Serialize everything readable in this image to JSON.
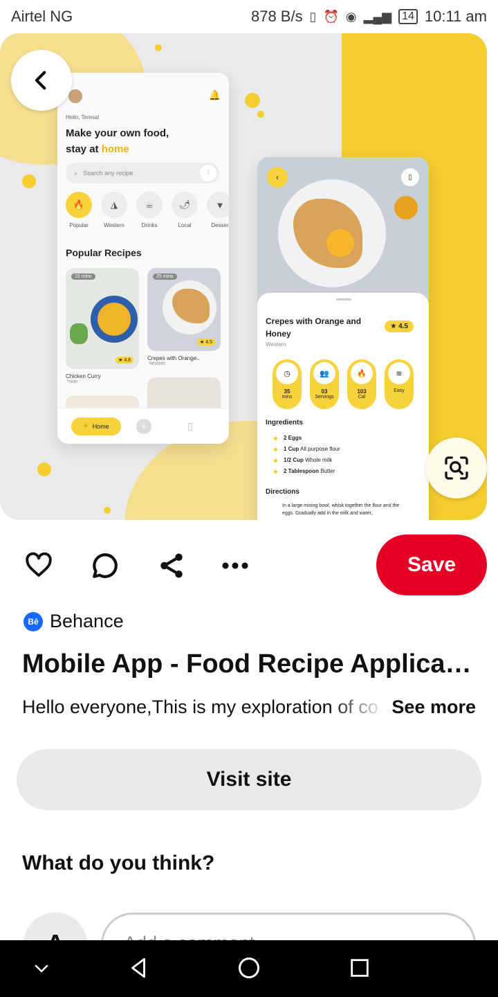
{
  "status_bar": {
    "carrier": "Airtel NG",
    "speed": "878 B/s",
    "battery": "14",
    "time": "10:11 am"
  },
  "hero": {
    "mockup_home": {
      "greeting": "Hello, Teresa!",
      "tagline_line1": "Make your own food,",
      "tagline_line2_prefix": "stay at ",
      "tagline_line2_highlight": "home",
      "search_placeholder": "Search any recipe",
      "categories": [
        "Popular",
        "Western",
        "Drinks",
        "Local",
        "Desser"
      ],
      "section_title": "Popular Recipes",
      "card1_time": "15 mins",
      "card1_rating": "★ 4.8",
      "card1_name": "Chicken Curry",
      "card1_origin": "Asian",
      "card2_time": "25 mins",
      "card2_rating": "★ 4.5",
      "card2_name": "Crepes with Orange..",
      "card2_origin": "Western",
      "nav_home": "Home"
    },
    "mockup_detail": {
      "title": "Crepes with Orange and Honey",
      "origin": "Western",
      "rating": "★ 4.5",
      "stats": [
        {
          "value": "35",
          "label": "mins"
        },
        {
          "value": "03",
          "label": "Servings"
        },
        {
          "value": "103",
          "label": "Cal"
        },
        {
          "value": "",
          "label": "Easy"
        }
      ],
      "ingredients_heading": "Ingredients",
      "ingredients": [
        {
          "qty": "2 Eggs",
          "item": ""
        },
        {
          "qty": "1 Cup",
          "item": "All purpose flour"
        },
        {
          "qty": "1/2 Cup",
          "item": "Whole milk"
        },
        {
          "qty": "2 Tablespoon",
          "item": "Butter"
        }
      ],
      "directions_heading": "Directions",
      "directions_text": "In a large mixing bowl, whisk together the flour and the eggs. Gradually add in the milk and water,"
    }
  },
  "actions": {
    "save_label": "Save"
  },
  "pin": {
    "source": "Behance",
    "source_logo_text": "Bē",
    "title": "Mobile App - Food Recipe Application",
    "description": "Hello everyone,This is my exploration of co",
    "see_more": "See more",
    "visit_label": "Visit site"
  },
  "comments": {
    "heading": "What do you think?",
    "avatar_initial": "A",
    "placeholder": "Add a comment"
  },
  "colors": {
    "accent_yellow": "#f4cd30",
    "save_red": "#e60023",
    "behance_blue": "#1769ff"
  },
  "icons": {
    "heart": "heart-icon",
    "comment": "comment-icon",
    "share": "share-icon",
    "more": "more-icon",
    "lens": "visual-search-icon"
  }
}
